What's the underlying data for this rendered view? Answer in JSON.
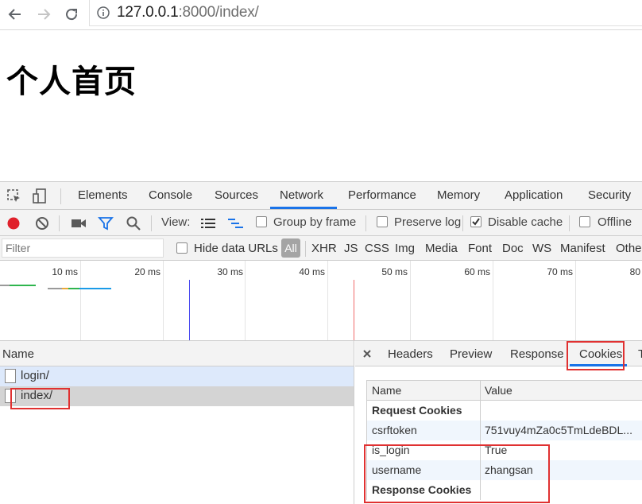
{
  "browser": {
    "url_host": "127.0.0.1",
    "url_path": ":8000/index/"
  },
  "page": {
    "heading": "个人首页"
  },
  "devtools": {
    "tabs": [
      "Elements",
      "Console",
      "Sources",
      "Network",
      "Performance",
      "Memory",
      "Application",
      "Security"
    ],
    "active_tab": "Network",
    "toolbar": {
      "view_label": "View:",
      "group_by_frame": "Group by frame",
      "preserve_log": "Preserve log",
      "disable_cache": "Disable cache",
      "disable_cache_checked": true,
      "offline": "Offline"
    },
    "filter": {
      "placeholder": "Filter",
      "hide_data_urls": "Hide data URLs",
      "all": "All",
      "types": [
        "XHR",
        "JS",
        "CSS",
        "Img",
        "Media",
        "Font",
        "Doc",
        "WS",
        "Manifest",
        "Othe"
      ]
    },
    "timeline_ticks": [
      "10 ms",
      "20 ms",
      "30 ms",
      "40 ms",
      "50 ms",
      "60 ms",
      "70 ms",
      "80"
    ],
    "requests": {
      "header": "Name",
      "items": [
        "login/",
        "index/"
      ]
    },
    "detail": {
      "tabs": [
        "Headers",
        "Preview",
        "Response",
        "Cookies",
        "T"
      ],
      "active_tab": "Cookies",
      "cookies": {
        "columns": [
          "Name",
          "Value"
        ],
        "section_request": "Request Cookies",
        "section_response": "Response Cookies",
        "rows": [
          {
            "name": "csrftoken",
            "value": "751vuy4mZa0c5TmLdeBDL..."
          },
          {
            "name": "is_login",
            "value": "True"
          },
          {
            "name": "username",
            "value": "zhangsan"
          }
        ]
      }
    }
  },
  "colors": {
    "record": "#e0212b",
    "accent": "#1a73e8",
    "highlight": "#e03131"
  }
}
